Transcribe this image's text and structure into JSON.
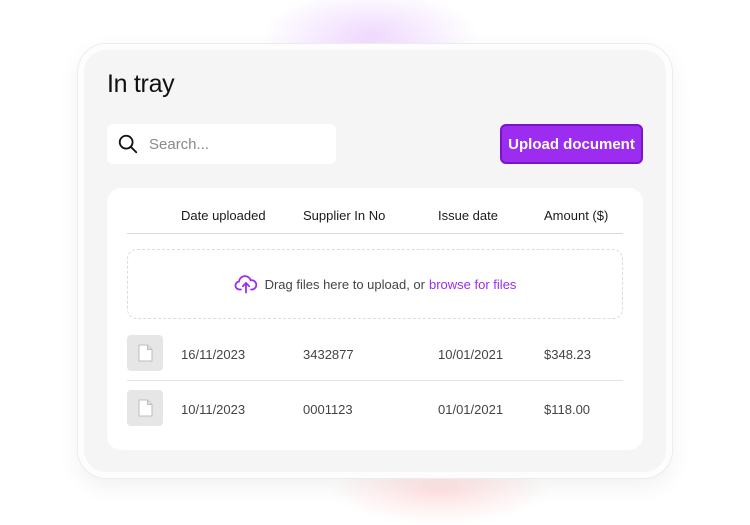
{
  "page": {
    "title": "In tray"
  },
  "search": {
    "placeholder": "Search...",
    "icon": "search-icon"
  },
  "toolbar": {
    "upload_label": "Upload document"
  },
  "table": {
    "columns": [
      "Date uploaded",
      "Supplier In No",
      "Issue date",
      "Amount ($)"
    ],
    "dropzone": {
      "text": "Drag files here to upload, or",
      "link": "browse for files",
      "icon": "cloud-upload-icon"
    },
    "rows": [
      {
        "date_uploaded": "16/11/2023",
        "supplier_no": "3432877",
        "issue_date": "10/01/2021",
        "amount": "$348.23",
        "icon": "document-icon"
      },
      {
        "date_uploaded": "10/11/2023",
        "supplier_no": "0001123",
        "issue_date": "01/01/2021",
        "amount": "$118.00",
        "icon": "document-icon"
      }
    ]
  },
  "colors": {
    "accent": "#9b2cf0",
    "accent_border": "#7a14c9",
    "panel_bg": "#f5f5f5",
    "card_bg": "#ffffff"
  }
}
